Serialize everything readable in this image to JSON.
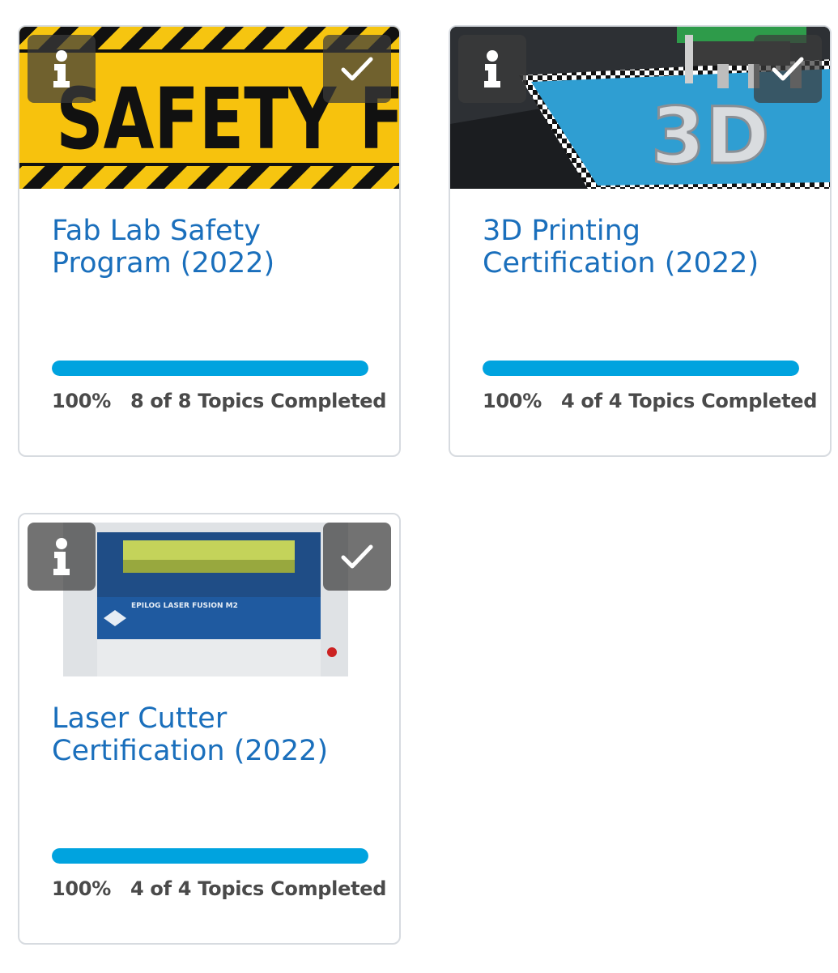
{
  "courses": [
    {
      "title": "Fab Lab Safety Program (2022)",
      "image_label": "SAFETY FI",
      "progress_percent": 100,
      "percent_text": "100%",
      "topics_text": "8 of 8 Topics Completed"
    },
    {
      "title": "3D Printing Certification (2022)",
      "image_label": "3D",
      "progress_percent": 100,
      "percent_text": "100%",
      "topics_text": "4 of 4 Topics Completed"
    },
    {
      "title": "Laser Cutter Certification (2022)",
      "image_label": "EPILOG LASER FUSION M2",
      "progress_percent": 100,
      "percent_text": "100%",
      "topics_text": "4 of 4 Topics Completed"
    }
  ],
  "icons": {
    "info": "info-icon",
    "check": "checkmark-icon"
  },
  "colors": {
    "title": "#1a6fbc",
    "progress": "#00a3df",
    "text": "#4a4a4a",
    "border": "#d7dbe0"
  }
}
